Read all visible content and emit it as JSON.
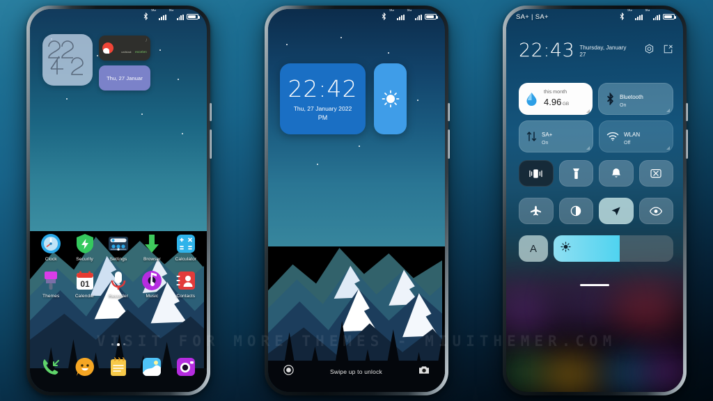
{
  "watermark": "VISIT  FOR  MORE  THEMES  -  MIUITHEMER.COM",
  "colors": {
    "bg_top": "#2a7fa0",
    "bg_bottom": "#010a11",
    "accent_blue": "#1a6fc4",
    "weather_blue": "#3f9de8",
    "slider_cyan": "#4fd3f0",
    "date_widget_purple": "#7b82c9"
  },
  "phone1": {
    "name": "home-screen",
    "statusbar": {
      "bluetooth": "bluetooth-icon",
      "signal1": "5G",
      "signal2": "5G",
      "battery": "battery-icon"
    },
    "widgets": {
      "clock_digits": "22:42",
      "note": {
        "line1": "calidad:",
        "line2": "excelen",
        "slash": "/"
      },
      "date": "Thu, 27 Januar"
    },
    "apps_row1": [
      {
        "label": "Clock",
        "icon": "clock-icon"
      },
      {
        "label": "Security",
        "icon": "shield-bolt-icon"
      },
      {
        "label": "Settings",
        "icon": "settings-sliders-icon"
      },
      {
        "label": "Browser",
        "icon": "download-arrow-icon"
      },
      {
        "label": "Calculator",
        "icon": "calculator-icon"
      }
    ],
    "apps_row2": [
      {
        "label": "Themes",
        "icon": "paintbrush-icon"
      },
      {
        "label": "Calendar",
        "icon": "calendar-icon",
        "day": "01"
      },
      {
        "label": "Recorder",
        "icon": "microphone-icon"
      },
      {
        "label": "Music",
        "icon": "music-note-icon"
      },
      {
        "label": "Contacts",
        "icon": "contacts-icon"
      }
    ],
    "dock": [
      {
        "label": "Phone",
        "icon": "phone-icon"
      },
      {
        "label": "Messages",
        "icon": "chat-smiley-icon"
      },
      {
        "label": "Notes",
        "icon": "notes-icon"
      },
      {
        "label": "Gallery",
        "icon": "gallery-icon"
      },
      {
        "label": "Camera",
        "icon": "camera-icon"
      }
    ],
    "page_indicator": {
      "total": 3,
      "active": 2
    }
  },
  "phone2": {
    "name": "lock-screen",
    "statusbar": {
      "signal1": "5G",
      "signal2": "5G"
    },
    "clock_widget": {
      "time": "22:42",
      "date": "Thu, 27 January 2022",
      "meridiem": "PM"
    },
    "weather_widget": {
      "icon": "sun-icon"
    },
    "bottom": {
      "left_icon": "record-circle-icon",
      "hint": "Swipe up to unlock",
      "right_icon": "camera-icon"
    }
  },
  "phone3": {
    "name": "control-center",
    "statusbar": {
      "carrier": "SA+ | SA+",
      "bluetooth": "bluetooth-icon",
      "signal1": "5G",
      "signal2": "5G"
    },
    "header": {
      "time": "22:43",
      "date_line1": "Thursday, January",
      "date_line2": "27",
      "settings_icon": "gear-icon",
      "edit_icon": "edit-square-icon"
    },
    "big_tiles": [
      {
        "icon": "water-drop-icon",
        "title": "this month",
        "value": "4.96",
        "unit": "GB",
        "style": "light"
      },
      {
        "icon": "bluetooth-icon",
        "title": "Bluetooth",
        "state": "On",
        "style": "glass"
      },
      {
        "icon": "data-transfer-icon",
        "title": "SA+",
        "state": "On",
        "style": "glass"
      },
      {
        "icon": "wifi-icon",
        "title": "WLAN",
        "state": "Off",
        "style": "glass2"
      }
    ],
    "toggles_row1": [
      {
        "icon": "vibrate-icon",
        "name": "vibrate-toggle",
        "active": true
      },
      {
        "icon": "flashlight-icon",
        "name": "flashlight-toggle",
        "active": false
      },
      {
        "icon": "bell-icon",
        "name": "ringer-toggle",
        "active": false
      },
      {
        "icon": "screenshot-icon",
        "name": "screenshot-toggle",
        "active": false
      }
    ],
    "toggles_row2": [
      {
        "icon": "airplane-icon",
        "name": "airplane-toggle",
        "active": false
      },
      {
        "icon": "dark-mode-icon",
        "name": "dark-mode-toggle",
        "active": false
      },
      {
        "icon": "location-arrow-icon",
        "name": "location-toggle",
        "active": true
      },
      {
        "icon": "eye-icon",
        "name": "reading-mode-toggle",
        "active": false
      }
    ],
    "brightness": {
      "auto_label": "A",
      "icon": "brightness-sun-icon",
      "percent": 55
    }
  }
}
